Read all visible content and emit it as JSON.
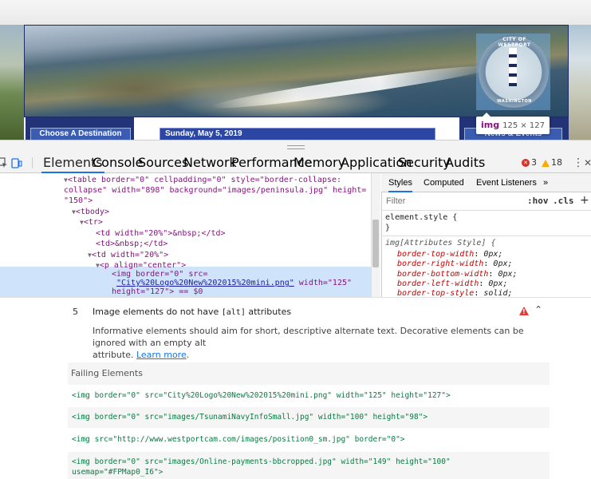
{
  "website": {
    "logo_top_text": "CITY OF WESTPORT",
    "logo_bottom_text": "WASHINGTON",
    "left_button": "Choose A Destination",
    "date_bar": "Sunday, May 5, 2019",
    "right_button": "News & Events"
  },
  "tooltip": {
    "tag": "img",
    "dims": "125 × 127"
  },
  "devtools": {
    "tabs": [
      "Elements",
      "Console",
      "Sources",
      "Network",
      "Performance",
      "Memory",
      "Application",
      "Security",
      "Audits"
    ],
    "active_tab": "Elements",
    "error_count": "3",
    "warning_count": "18",
    "more_tabs": "»",
    "menu": "⋮",
    "close": "✕"
  },
  "dom": {
    "line1_a": "<table border=\"0\" cellpadding=\"0\" style=\"border-collapse:",
    "line1_b": "collapse\" width=\"898\" background=\"images/peninsula.jpg\" height=",
    "line1_c": "\"150\">",
    "tbody": "<tbody>",
    "tr": "<tr>",
    "td1": "<td width=\"20%\">&nbsp;</td>",
    "td2": "<td>&nbsp;</td>",
    "td3": "<td width=\"20%\">",
    "p": "<p align=\"center\">",
    "img_a": "<img border=\"0\" src=",
    "img_src": "\"City%20Logo%20New%202015%20mini.png\"",
    "img_b": " width=\"125\"",
    "img_c": "height=\"127\"> == $0"
  },
  "styles": {
    "tabs": [
      "Styles",
      "Computed",
      "Event Listeners"
    ],
    "more": "»",
    "filter_placeholder": "Filter",
    "hov": ":hov",
    "cls": ".cls",
    "plus": "+",
    "element_style": "element.style {",
    "close_brace": "}",
    "attr_rule": "img[Attributes Style] {",
    "props": [
      {
        "name": "border-top-width",
        "value": "0px;"
      },
      {
        "name": "border-right-width",
        "value": "0px;"
      },
      {
        "name": "border-bottom-width",
        "value": "0px;"
      },
      {
        "name": "border-left-width",
        "value": "0px;"
      },
      {
        "name": "border-top-style",
        "value": "solid;"
      }
    ]
  },
  "audit": {
    "number": "5",
    "title_pre": "Image elements do not have ",
    "title_code": "[alt]",
    "title_post": " attributes",
    "description_line1": "Informative elements should aim for short, descriptive alternate text. Decorative elements can be ignored with an empty alt",
    "description_line2": "attribute.",
    "learn_more": "Learn more",
    "failing_header": "Failing Elements",
    "failing_elements": [
      "<img border=\"0\" src=\"City%20Logo%20New%202015%20mini.png\" width=\"125\" height=\"127\">",
      "<img border=\"0\" src=\"images/TsunamiNavyInfoSmall.jpg\" width=\"100\" height=\"98\">",
      "<img src=\"http://www.westportcam.com/images/position0_sm.jpg\" border=\"0\">",
      "<img border=\"0\" src=\"images/Online-payments-bbcropped.jpg\" width=\"149\" height=\"100\"",
      "usemap=\"#FPMap0_I6\">"
    ]
  }
}
